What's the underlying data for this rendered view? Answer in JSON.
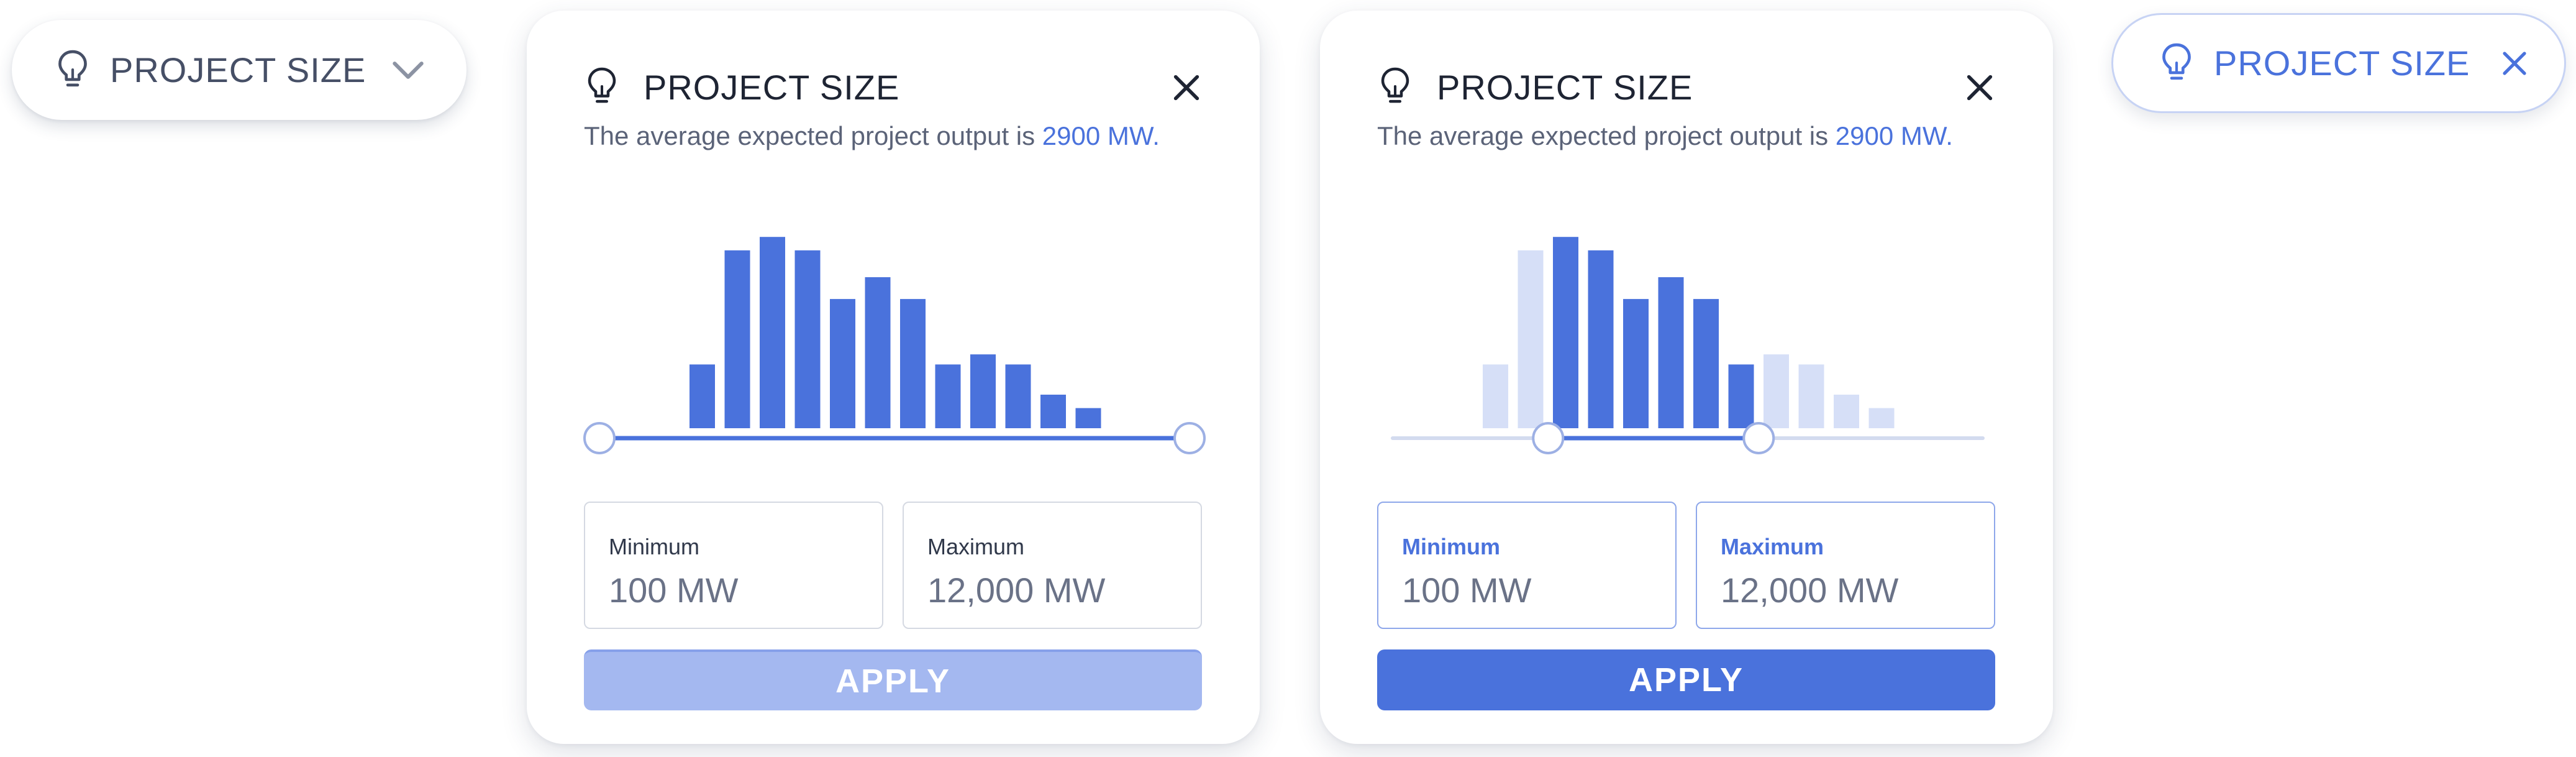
{
  "colors": {
    "accent": "#4a72dc",
    "bar_muted": "#d6dff7",
    "apply_disabled": "#a4b8f0",
    "title_text": "#1e2433"
  },
  "pill_collapsed": {
    "icon": "lightbulb-icon",
    "label": "PROJECT SIZE",
    "toggle_icon": "chevron-down-icon"
  },
  "pill_active": {
    "icon": "lightbulb-icon",
    "label": "PROJECT SIZE",
    "toggle_icon": "close-icon"
  },
  "card_full_range": {
    "title": "PROJECT SIZE",
    "subtitle_prefix": "The average expected project output is ",
    "subtitle_value": "2900 MW.",
    "histogram": {
      "values": [
        38,
        106,
        114,
        106,
        77,
        90,
        77,
        38,
        44,
        38,
        20,
        12
      ],
      "range_selected": [
        0,
        12
      ]
    },
    "min_label": "Minimum",
    "min_value": "100 MW",
    "max_label": "Maximum",
    "max_value": "12,000 MW",
    "apply_label": "APPLY",
    "apply_enabled": false
  },
  "card_narrowed": {
    "title": "PROJECT SIZE",
    "subtitle_prefix": "The average expected project output is ",
    "subtitle_value": "2900 MW.",
    "histogram": {
      "values": [
        38,
        106,
        114,
        106,
        77,
        90,
        77,
        38,
        44,
        38,
        20,
        12
      ],
      "range_selected": [
        2,
        8
      ]
    },
    "min_label": "Minimum",
    "min_value": "100 MW",
    "max_label": "Maximum",
    "max_value": "12,000 MW",
    "apply_label": "APPLY",
    "apply_enabled": true
  }
}
